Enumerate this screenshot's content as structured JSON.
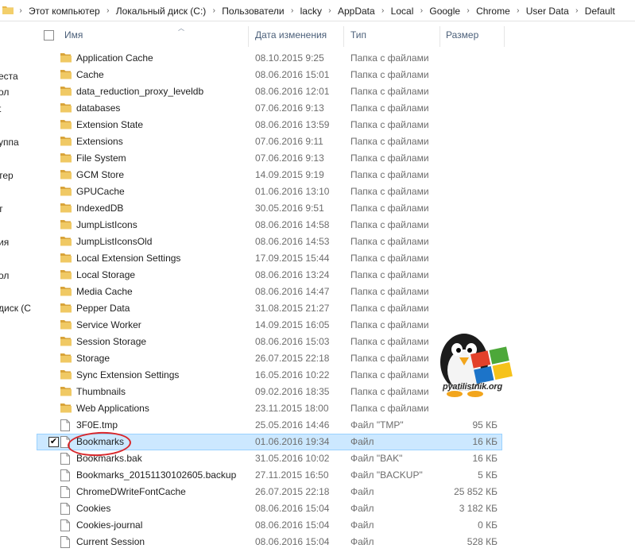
{
  "breadcrumb": [
    "Этот компьютер",
    "Локальный диск (C:)",
    "Пользователи",
    "lacky",
    "AppData",
    "Local",
    "Google",
    "Chrome",
    "User Data",
    "Default"
  ],
  "nav_items": [
    "еста",
    "ол",
    "t",
    "уппа",
    "тер",
    "т",
    "ия",
    "ол",
    "диск (С"
  ],
  "columns": {
    "name": "Имя",
    "date": "Дата изменения",
    "type": "Тип",
    "size": "Размер"
  },
  "rows": [
    {
      "name": "Application Cache",
      "date": "08.10.2015 9:25",
      "type": "Папка с файлами",
      "size": "",
      "kind": "folder"
    },
    {
      "name": "Cache",
      "date": "08.06.2016 15:01",
      "type": "Папка с файлами",
      "size": "",
      "kind": "folder"
    },
    {
      "name": "data_reduction_proxy_leveldb",
      "date": "08.06.2016 12:01",
      "type": "Папка с файлами",
      "size": "",
      "kind": "folder"
    },
    {
      "name": "databases",
      "date": "07.06.2016 9:13",
      "type": "Папка с файлами",
      "size": "",
      "kind": "folder"
    },
    {
      "name": "Extension State",
      "date": "08.06.2016 13:59",
      "type": "Папка с файлами",
      "size": "",
      "kind": "folder"
    },
    {
      "name": "Extensions",
      "date": "07.06.2016 9:11",
      "type": "Папка с файлами",
      "size": "",
      "kind": "folder"
    },
    {
      "name": "File System",
      "date": "07.06.2016 9:13",
      "type": "Папка с файлами",
      "size": "",
      "kind": "folder"
    },
    {
      "name": "GCM Store",
      "date": "14.09.2015 9:19",
      "type": "Папка с файлами",
      "size": "",
      "kind": "folder"
    },
    {
      "name": "GPUCache",
      "date": "01.06.2016 13:10",
      "type": "Папка с файлами",
      "size": "",
      "kind": "folder"
    },
    {
      "name": "IndexedDB",
      "date": "30.05.2016 9:51",
      "type": "Папка с файлами",
      "size": "",
      "kind": "folder"
    },
    {
      "name": "JumpListIcons",
      "date": "08.06.2016 14:58",
      "type": "Папка с файлами",
      "size": "",
      "kind": "folder"
    },
    {
      "name": "JumpListIconsOld",
      "date": "08.06.2016 14:53",
      "type": "Папка с файлами",
      "size": "",
      "kind": "folder"
    },
    {
      "name": "Local Extension Settings",
      "date": "17.09.2015 15:44",
      "type": "Папка с файлами",
      "size": "",
      "kind": "folder"
    },
    {
      "name": "Local Storage",
      "date": "08.06.2016 13:24",
      "type": "Папка с файлами",
      "size": "",
      "kind": "folder"
    },
    {
      "name": "Media Cache",
      "date": "08.06.2016 14:47",
      "type": "Папка с файлами",
      "size": "",
      "kind": "folder"
    },
    {
      "name": "Pepper Data",
      "date": "31.08.2015 21:27",
      "type": "Папка с файлами",
      "size": "",
      "kind": "folder"
    },
    {
      "name": "Service Worker",
      "date": "14.09.2015 16:05",
      "type": "Папка с файлами",
      "size": "",
      "kind": "folder"
    },
    {
      "name": "Session Storage",
      "date": "08.06.2016 15:03",
      "type": "Папка с файлами",
      "size": "",
      "kind": "folder"
    },
    {
      "name": "Storage",
      "date": "26.07.2015 22:18",
      "type": "Папка с файлами",
      "size": "",
      "kind": "folder"
    },
    {
      "name": "Sync Extension Settings",
      "date": "16.05.2016 10:22",
      "type": "Папка с файлами",
      "size": "",
      "kind": "folder"
    },
    {
      "name": "Thumbnails",
      "date": "09.02.2016 18:35",
      "type": "Папка с файлами",
      "size": "",
      "kind": "folder"
    },
    {
      "name": "Web Applications",
      "date": "23.11.2015 18:00",
      "type": "Папка с файлами",
      "size": "",
      "kind": "folder"
    },
    {
      "name": "3F0E.tmp",
      "date": "25.05.2016 14:46",
      "type": "Файл \"TMP\"",
      "size": "95 КБ",
      "kind": "file"
    },
    {
      "name": "Bookmarks",
      "date": "01.06.2016 19:34",
      "type": "Файл",
      "size": "16 КБ",
      "kind": "file",
      "selected": true
    },
    {
      "name": "Bookmarks.bak",
      "date": "31.05.2016 10:02",
      "type": "Файл \"BAK\"",
      "size": "16 КБ",
      "kind": "file"
    },
    {
      "name": "Bookmarks_20151130102605.backup",
      "date": "27.11.2015 16:50",
      "type": "Файл \"BACKUP\"",
      "size": "5 КБ",
      "kind": "file"
    },
    {
      "name": "ChromeDWriteFontCache",
      "date": "26.07.2015 22:18",
      "type": "Файл",
      "size": "25 852 КБ",
      "kind": "file"
    },
    {
      "name": "Cookies",
      "date": "08.06.2016 15:04",
      "type": "Файл",
      "size": "3 182 КБ",
      "kind": "file"
    },
    {
      "name": "Cookies-journal",
      "date": "08.06.2016 15:04",
      "type": "Файл",
      "size": "0 КБ",
      "kind": "file"
    },
    {
      "name": "Current Session",
      "date": "08.06.2016 15:04",
      "type": "Файл",
      "size": "528 КБ",
      "kind": "file"
    }
  ],
  "logo_text": "pyatilistnik.org",
  "colors": {
    "folder": "#e8b84a",
    "selection": "#cce8ff",
    "annotation": "#d9262a",
    "header_text": "#4c607a"
  }
}
